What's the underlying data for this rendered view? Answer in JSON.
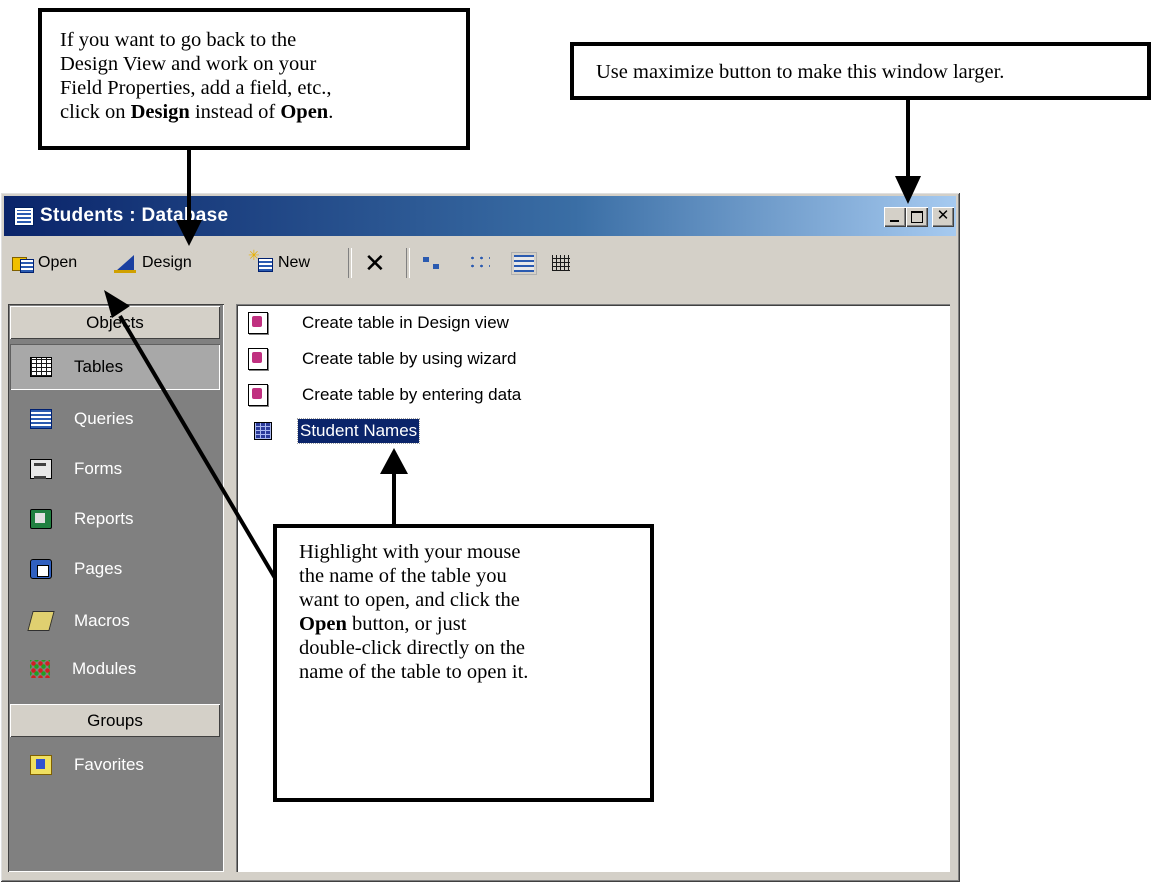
{
  "window": {
    "title": "Students : Database"
  },
  "toolbar": {
    "open_label": "Open",
    "design_label": "Design",
    "new_label": "New"
  },
  "objects_bar": {
    "objects_header": "Objects",
    "groups_header": "Groups",
    "items": [
      {
        "label": "Tables",
        "icon": "tables-icon",
        "selected": true
      },
      {
        "label": "Queries",
        "icon": "queries-icon"
      },
      {
        "label": "Forms",
        "icon": "forms-icon"
      },
      {
        "label": "Reports",
        "icon": "reports-icon"
      },
      {
        "label": "Pages",
        "icon": "pages-icon"
      },
      {
        "label": "Macros",
        "icon": "macros-icon"
      },
      {
        "label": "Modules",
        "icon": "modules-icon"
      }
    ],
    "groups": [
      {
        "label": "Favorites",
        "icon": "favorites-icon"
      }
    ]
  },
  "list": {
    "items": [
      {
        "label": "Create table in Design view",
        "icon": "wizard-icon"
      },
      {
        "label": "Create table by using wizard",
        "icon": "wizard-icon"
      },
      {
        "label": "Create table by entering data",
        "icon": "wizard-icon"
      },
      {
        "label": "Student Names",
        "icon": "table-icon",
        "selected": true
      }
    ]
  },
  "callouts": {
    "design": {
      "line1": "If you want to go back to the",
      "line2": "Design View and work on your",
      "line3": "Field Properties, add a field, etc.,",
      "line4_pre": "click on ",
      "line4_bold1": "Design",
      "line4_mid": " instead of ",
      "line4_bold2": "Open",
      "line4_post": "."
    },
    "maximize": {
      "text": "Use maximize button to make this window larger."
    },
    "highlight": {
      "line1": "Highlight with your mouse",
      "line2": "the name of the table you",
      "line3": "want to open, and click the",
      "line4_bold": "Open",
      "line4_rest": " button, or just",
      "line5": "double-click directly on the",
      "line6": "name of the table to open it."
    }
  }
}
